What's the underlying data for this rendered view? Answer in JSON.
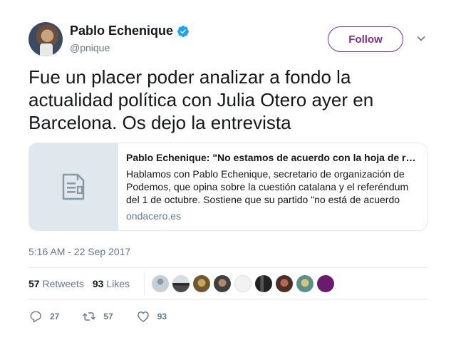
{
  "user": {
    "name": "Pablo Echenique",
    "handle": "@pnique",
    "verified": true,
    "follow_label": "Follow"
  },
  "tweet": {
    "text": "Fue un placer poder analizar a fondo la actualidad política con Julia Otero ayer en Barcelona. Os dejo la entrevista",
    "timestamp": "5:16 AM - 22 Sep 2017"
  },
  "card": {
    "title": "Pablo Echenique: \"No estamos de acuerdo con la hoja de ruta del Govern, pero sí con el referéndum\"",
    "description": "Hablamos con Pablo Echenique, secretario de organización de Podemos, que opina sobre la cuestión catalana y el referéndum del 1 de octubre. Sostiene que su partido \"no está de acuerdo con",
    "domain": "ondacero.es",
    "thumbnail_icon": "document-icon"
  },
  "stats": {
    "retweets_count": "57",
    "retweets_label": "Retweets",
    "likes_count": "93",
    "likes_label": "Likes"
  },
  "actions": {
    "replies": "27",
    "retweets": "57",
    "likes": "93"
  },
  "colors": {
    "accent": "#7d2e8e",
    "verified": "#1da1f2",
    "muted": "#657786",
    "border": "#e6ecf0"
  }
}
